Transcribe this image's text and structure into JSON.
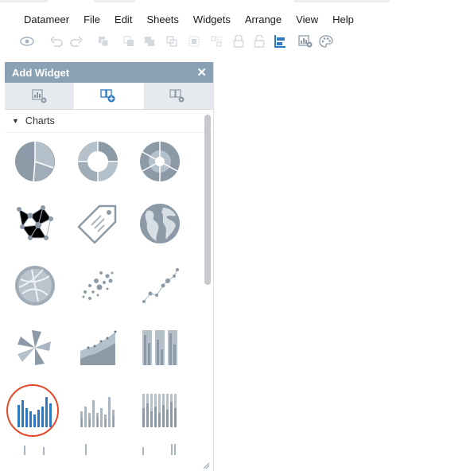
{
  "menu": [
    "Datameer",
    "File",
    "Edit",
    "Sheets",
    "Widgets",
    "Arrange",
    "View",
    "Help"
  ],
  "toolbar_icons": [
    "eye-icon",
    "undo-icon",
    "redo-icon",
    "copy-icon",
    "paste-icon",
    "bring-front-icon",
    "send-back-icon",
    "group-icon",
    "ungroup-icon",
    "lock-icon",
    "unlock-icon",
    "align-left-icon",
    "add-widget-icon",
    "theme-palette-icon"
  ],
  "panel": {
    "title": "Add Widget",
    "close": "✕",
    "tabs": [
      "chart-settings-icon",
      "add-widget-icon",
      "widget-settings-icon"
    ],
    "section": "Charts"
  },
  "colors": {
    "panel_header": "#8aa0b4",
    "icon": "#a9b6c1",
    "icon_dark": "#8c9aa7",
    "selected_icon": "#2f79c1",
    "highlight_ring": "#e34a2b"
  },
  "widgets": [
    "pie-chart-icon",
    "donut-chart-icon",
    "sunburst-chart-icon",
    "network-graph-icon",
    "tag-cloud-icon",
    "world-map-icon",
    "chord-chart-icon",
    "bubble-scatter-icon",
    "line-scatter-icon",
    "radar-pie-icon",
    "area-chart-icon",
    "stacked-column-icon",
    "column-chart-icon",
    "grouped-column-icon",
    "stacked-bar-icon"
  ]
}
